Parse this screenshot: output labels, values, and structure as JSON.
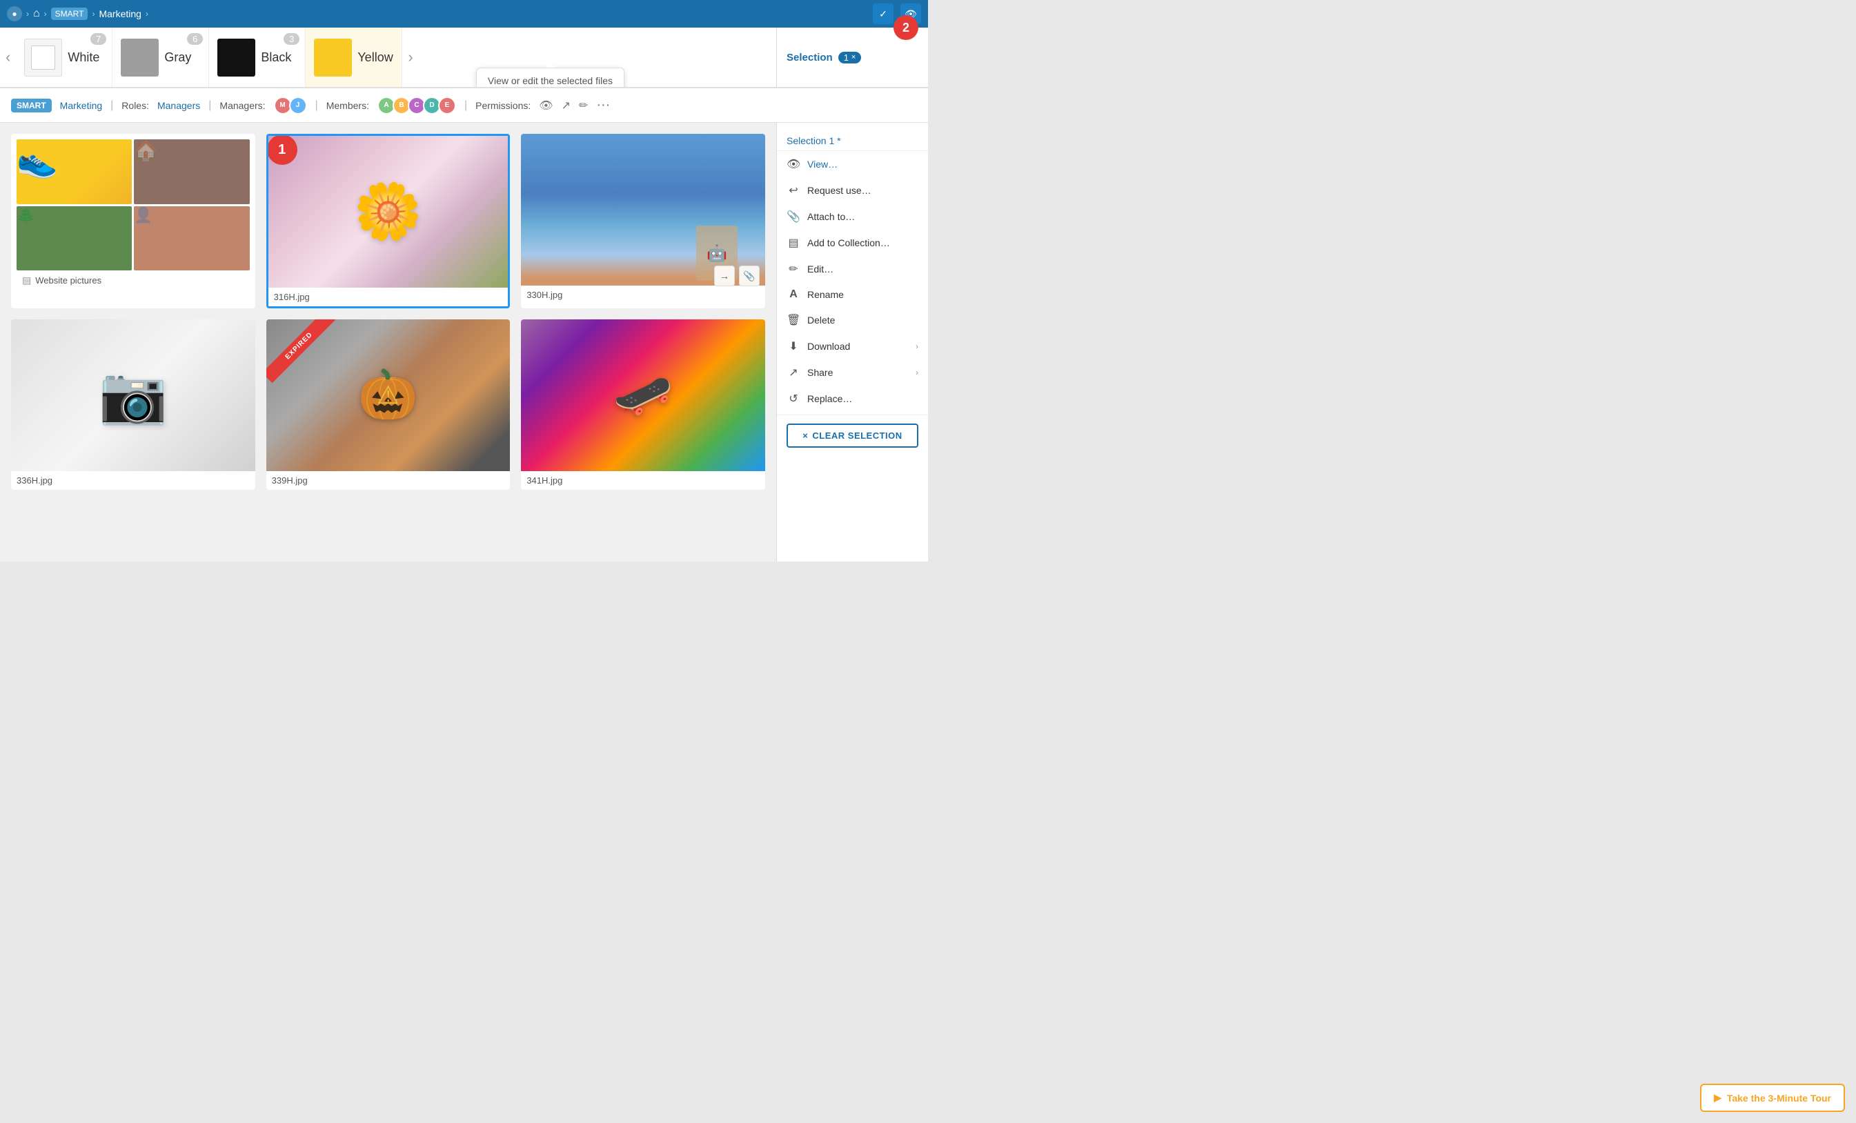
{
  "topbar": {
    "brand_icon": "●",
    "breadcrumb_sep": ">",
    "home_icon": "⌂",
    "folder_label": "SMART",
    "title": "Marketing",
    "title_arrow": "›",
    "checkmark_btn": "✓",
    "eye_btn": "👁"
  },
  "tabs": [
    {
      "label": "White",
      "count": "7",
      "color": "white"
    },
    {
      "label": "Gray",
      "count": "6",
      "color": "gray"
    },
    {
      "label": "Black",
      "count": "3",
      "color": "black"
    },
    {
      "label": "Yellow",
      "count": "",
      "color": "yellow"
    }
  ],
  "tooltip": {
    "text": "View or edit the selected files"
  },
  "selection": {
    "label": "Selection",
    "tab_name": "Selection 1 *",
    "count": "1",
    "close_icon": "×"
  },
  "toolbar": {
    "brand": "SMART",
    "section_label": "Marketing",
    "roles_label": "Roles:",
    "managers_label": "Managers:",
    "managers_name": "Managers",
    "members_label": "Members:",
    "permissions_label": "Permissions:",
    "more_icon": "···"
  },
  "gallery": {
    "items": [
      {
        "type": "collection",
        "label": "Website pictures",
        "selected": false
      },
      {
        "type": "image",
        "label": "316H.jpg",
        "selected": true,
        "badge": "1",
        "color": "#d4a0c0"
      },
      {
        "type": "image",
        "label": "330H.jpg",
        "selected": false,
        "color": "#5b9bd5"
      },
      {
        "type": "image",
        "label": "336H.jpg",
        "selected": false,
        "color": "#d0d0d0"
      },
      {
        "type": "image",
        "label": "339H.jpg",
        "selected": false,
        "color": "#c87941",
        "expired": true
      },
      {
        "type": "image",
        "label": "341H.jpg",
        "selected": false,
        "color": "#9c64a6"
      }
    ]
  },
  "right_panel": {
    "items": [
      {
        "icon": "👁",
        "label": "View…",
        "style": "view"
      },
      {
        "icon": "↩",
        "label": "Request use…"
      },
      {
        "icon": "📎",
        "label": "Attach to…"
      },
      {
        "icon": "▤",
        "label": "Add to Collection…"
      },
      {
        "icon": "✏",
        "label": "Edit…"
      },
      {
        "icon": "A",
        "label": "Rename"
      },
      {
        "icon": "🗑",
        "label": "Delete"
      },
      {
        "icon": "⬇",
        "label": "Download",
        "expand": "›"
      },
      {
        "icon": "↗",
        "label": "Share",
        "expand": "›"
      },
      {
        "icon": "↺",
        "label": "Replace…"
      }
    ],
    "clear_label": "CLEAR SELECTION",
    "clear_icon": "×"
  },
  "tour_btn": {
    "icon": "▶",
    "label": "Take the 3-Minute Tour"
  }
}
